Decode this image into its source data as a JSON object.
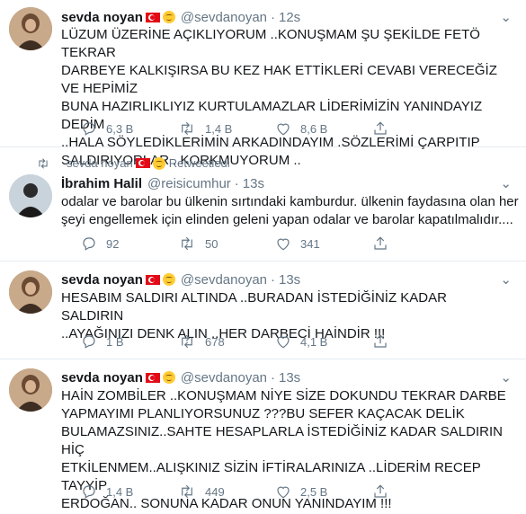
{
  "tweets": [
    {
      "name": "sevda noyan",
      "handle": "@sevdanoyan",
      "time": "12s",
      "text": "LÜZUM ÜZERİNE AÇIKLIYORUM ..KONUŞMAM ŞU ŞEKİLDE FETÖ TEKRAR\nDARBEYE KALKIŞIRSA BU KEZ HAK ETTİKLERİ CEVABI VERECEĞİZ VE HEPİMİZ\nBUNA HAZIRLIKLIYIZ KURTULAMAZLAR LİDERİMİZİN YANINDAYIZ DEDİM\n..HALA SÖYLEDİKLERİMİN ARKADINDAYIM .SÖZLERİMİ ÇARPITIP\nSALDIRIYORLAR ..KORKMUYORUM ..",
      "replies": "6,3 B",
      "retweets": "1,4 B",
      "likes": "8,6 B"
    },
    {
      "retweet_label": "sevda noyan",
      "retweet_suffix": "Retweetledi",
      "name": "İbrahim Halil",
      "handle": "@reisicumhur",
      "time": "13s",
      "text": "odalar ve barolar bu ülkenin sırtındaki kamburdur. ülkenin faydasına olan her\nşeyi engellemek için elinden geleni yapan odalar ve barolar kapatılmalıdır....",
      "replies": "92",
      "retweets": "50",
      "likes": "341"
    },
    {
      "name": "sevda noyan",
      "handle": "@sevdanoyan",
      "time": "13s",
      "text": "HESABIM SALDIRI ALTINDA ..BURADAN İSTEDİĞİNİZ KADAR SALDIRIN\n..AYAĞINIZI DENK ALIN ..HER DARBECİ HAİNDİR !!!",
      "replies": "1 B",
      "retweets": "678",
      "likes": "4,1 B"
    },
    {
      "name": "sevda noyan",
      "handle": "@sevdanoyan",
      "time": "13s",
      "text": "HAİN ZOMBİLER ..KONUŞMAM NİYE SİZE DOKUNDU TEKRAR DARBE\nYAPMAYIMI PLANLIYORSUNUZ ???BU SEFER KAÇACAK DELİK\nBULAMAZSINIZ..SAHTE HESAPLARLA İSTEDİĞİNİZ KADAR SALDIRIN HİÇ\nETKİLENMEM..ALIŞKINIZ SİZİN İFTİRALARINIZA ..LİDERİM RECEP TAYYİP\nERDOĞAN.. SONUNA KADAR ONUN YANINDAYIM !!!",
      "replies": "1,4 B",
      "retweets": "449",
      "likes": "2,5 B"
    }
  ],
  "ui": {
    "dot": "·",
    "chevron": "⌄"
  },
  "colors": {
    "accent": "#1da1f2",
    "muted": "#657786",
    "text": "#14171a",
    "divider": "#e6ecf0"
  },
  "icons": [
    "reply-icon",
    "retweet-icon",
    "like-icon",
    "share-icon",
    "chevron-down-icon",
    "turkey-flag-icon",
    "hugging-face-emoji-icon"
  ]
}
